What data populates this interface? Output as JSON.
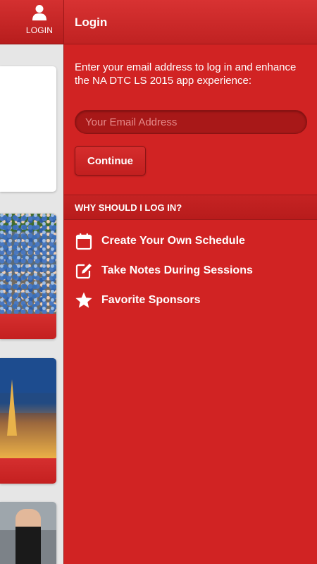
{
  "left_header": {
    "login_label": "LOGIN"
  },
  "panel": {
    "title": "Login",
    "intro_text": "Enter your email address to log in and enhance the NA DTC LS 2015 app experience:",
    "email_placeholder": "Your Email Address",
    "email_value": "",
    "continue_label": "Continue",
    "why_title": "WHY SHOULD I LOG IN?",
    "reasons": [
      {
        "icon": "calendar-icon",
        "label": "Create Your Own Schedule"
      },
      {
        "icon": "edit-note-icon",
        "label": "Take Notes During Sessions"
      },
      {
        "icon": "star-icon",
        "label": "Favorite Sponsors"
      }
    ]
  },
  "colors": {
    "brand_red": "#d12323",
    "header_red": "#c02222",
    "input_bg": "#a81818",
    "placeholder": "#e58a8a"
  }
}
